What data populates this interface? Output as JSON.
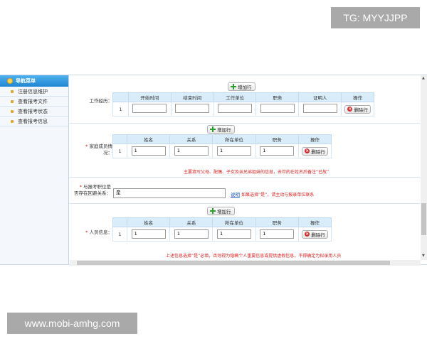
{
  "watermark_top": "TG: MYYJJPP",
  "watermark_bottom": "www.mobi-amhg.com",
  "sidebar": {
    "title": "导航菜单",
    "items": [
      {
        "label": "注册信息维护"
      },
      {
        "label": "查看报考文件"
      },
      {
        "label": "查看报考状态"
      },
      {
        "label": "查看报考信息"
      }
    ]
  },
  "work_history": {
    "label": "工作经历：",
    "add_label": "增加行",
    "columns": [
      "开始时间",
      "结束时间",
      "工作单位",
      "职务",
      "证明人",
      "操作"
    ],
    "rows": [
      {
        "index": "1",
        "values": [
          "",
          "",
          "",
          "",
          ""
        ],
        "delete_label": "删除行"
      }
    ]
  },
  "family": {
    "required_mark": "*",
    "label_line1": "家庭成员情",
    "label_line2": "况：",
    "add_label": "增加行",
    "columns": [
      "姓名",
      "关系",
      "所在单位",
      "职务",
      "操作"
    ],
    "rows": [
      {
        "index": "1",
        "values": [
          "1",
          "1",
          "1",
          "1"
        ],
        "delete_label": "删除行"
      }
    ],
    "note": "主要填写父母、配偶、子女及亲兄弟姐妹的信息，去世的在姓名后备注“已故”"
  },
  "relation": {
    "required_mark": "*",
    "label_line1": "与报考职位是",
    "label_line2": "否存在回避关系：",
    "value": "是",
    "link_text": "说明",
    "hint": "如果选择“是”，请主动与报录单位联系"
  },
  "personnel": {
    "required_mark": "*",
    "label": "人员信息：",
    "add_label": "增加行",
    "columns": [
      "姓名",
      "关系",
      "所在单位",
      "职务",
      "操作"
    ],
    "rows": [
      {
        "index": "1",
        "values": [
          "1",
          "1",
          "1",
          "1"
        ],
        "delete_label": "删除行"
      }
    ],
    "note": "上述信息选择“是”必填，否则视为隐瞒个人重要信息或提供虚假信息，不得确定为拟录用人员"
  }
}
